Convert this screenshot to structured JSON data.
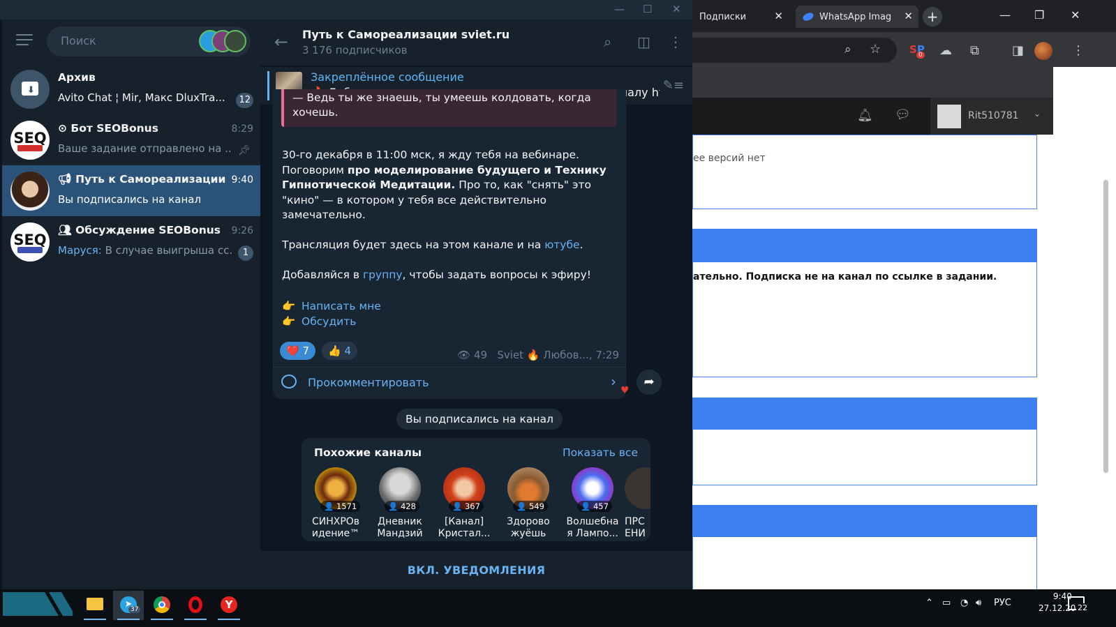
{
  "browser": {
    "tabs": [
      {
        "label": "Подписки"
      },
      {
        "label": "WhatsApp Imag"
      }
    ],
    "extension_badge": "0",
    "site": {
      "username": "Rit510781",
      "texts": {
        "no_versions": "ее версий нет",
        "warning": "ательно. Подписка не на канал по ссылке в задании."
      }
    }
  },
  "telegram": {
    "sidebar": {
      "search_placeholder": "Поиск",
      "chats": [
        {
          "name": "Архив",
          "preview": "Avito Chat ¦ Mir, Макс DluxTra...",
          "time": "",
          "badge": "12"
        },
        {
          "name": "Бот SEOBonus",
          "preview": "Ваше задание отправлено на ...",
          "time": "8:29",
          "badge": ""
        },
        {
          "name": "Путь к Самореализации s...",
          "preview": "Вы подписались на канал",
          "time": "9:40",
          "badge": ""
        },
        {
          "name": "Обсуждение SEOBonus",
          "preview_author": "Маруся:",
          "preview": "В случае выигрыша сс...",
          "time": "9:26",
          "badge": "1"
        }
      ]
    },
    "channel": {
      "title": "Путь к Самореализации sviet.ru",
      "subscribers": "3 176 подписчиков",
      "pinned": {
        "title": "Закреплённое сообщение",
        "text": "🔥 Добро пожаловать всем, кто присоединился к каналу htt..."
      },
      "message": {
        "quote": "— Ведь ты же знаешь, ты умеешь колдовать, когда хочешь.",
        "p1_start": "30-го декабря в 11:00 мск, я жду тебя на вебинаре. Поговорим ",
        "p1_bold": "про моделирование будущего и Технику Гипнотической Медитации.",
        "p1_end": " Про то, как \"снять\" это \"кино\" — в котором у тебя все действительно замечательно.",
        "p2_start": "Трансляция будет здесь на этом канале и на ",
        "p2_link": "ютубе",
        "p2_end": ".",
        "p3_start": "Добавляйся в ",
        "p3_link": "группу",
        "p3_end": ", чтобы задать вопросы к эфиру!",
        "cta1": "Написать мне",
        "cta2": "Обсудить",
        "reaction1": "7",
        "reaction2": "4",
        "views": "49",
        "author": "Sviet 🔥 Любов...",
        "time": "7:29",
        "comment_label": "Прокомментировать"
      },
      "service_message": "Вы подписались на канал",
      "similar": {
        "title": "Похожие каналы",
        "show_all": "Показать все",
        "channels": [
          {
            "name": "СИНХРОв\nидение™",
            "count": "1571"
          },
          {
            "name": "Дневник\nМандзий",
            "count": "428"
          },
          {
            "name": "[Канал]\nКристал...",
            "count": "367"
          },
          {
            "name": "Здорово\nжуёшь",
            "count": "549"
          },
          {
            "name": "Волшебна\nя Лампо...",
            "count": "457"
          },
          {
            "name": "ПРС\nЕНИ",
            "count": ""
          }
        ]
      },
      "notifications_button": "ВКЛ. УВЕДОМЛЕНИЯ"
    }
  },
  "taskbar": {
    "telegram_badge": "37",
    "language": "РУС",
    "time": "9:40",
    "date": "27.12.2023",
    "notifications": "22"
  }
}
